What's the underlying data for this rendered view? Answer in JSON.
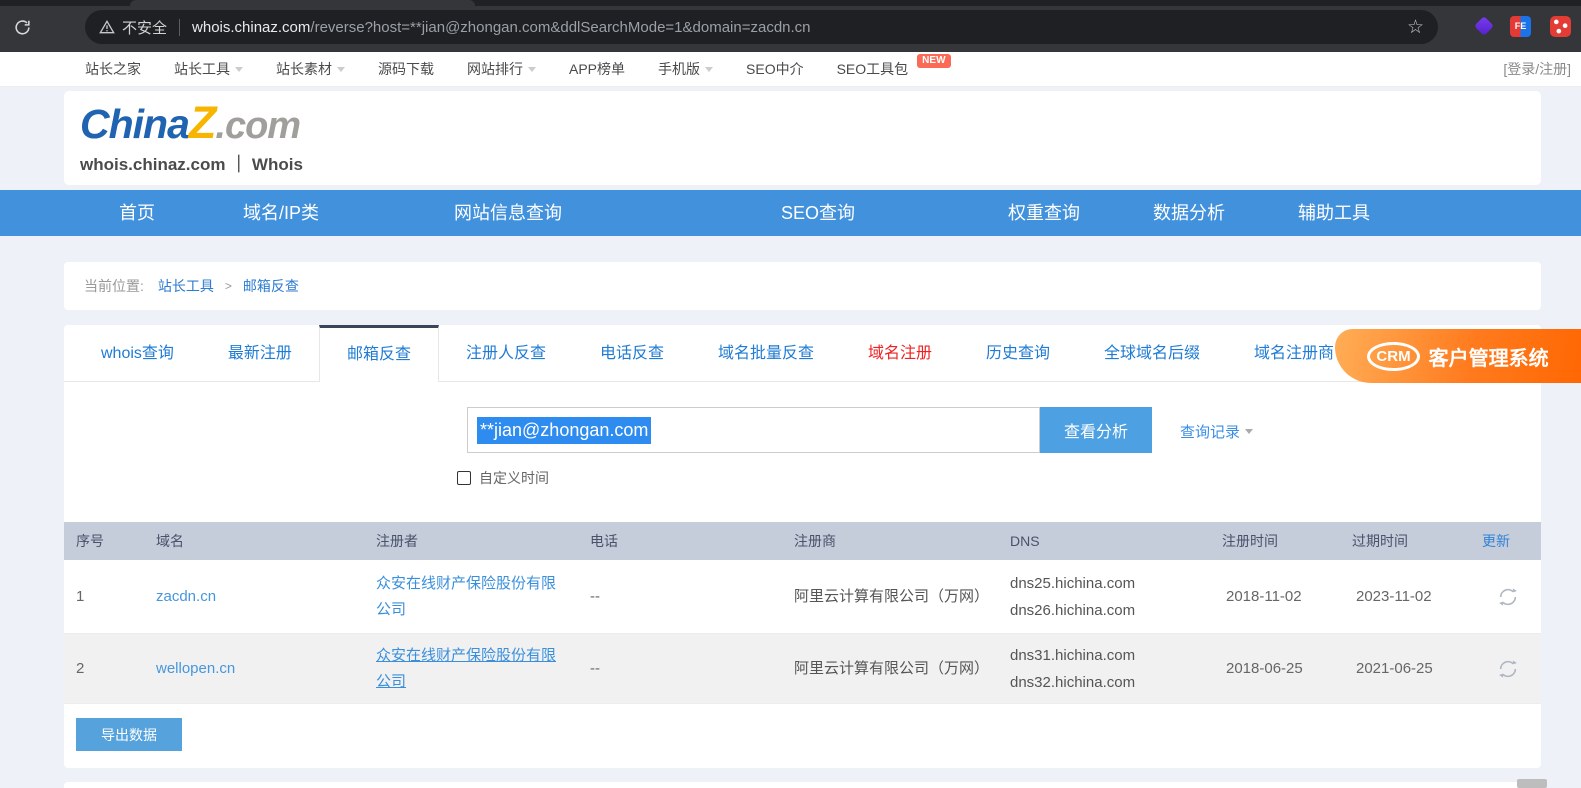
{
  "browser": {
    "security_label": "不安全",
    "url_host": "whois.chinaz.com",
    "url_rest": "/reverse?host=**jian@zhongan.com&ddlSearchMode=1&domain=zacdn.cn",
    "star_icon": "☆"
  },
  "topnav": {
    "items": [
      {
        "label": "站长之家"
      },
      {
        "label": "站长工具"
      },
      {
        "label": "站长素材"
      },
      {
        "label": "源码下载"
      },
      {
        "label": "网站排行"
      },
      {
        "label": "APP榜单"
      },
      {
        "label": "手机版"
      },
      {
        "label": "SEO中介"
      },
      {
        "label": "SEO工具包"
      }
    ],
    "new_badge": "NEW",
    "login": "[登录/注册]"
  },
  "header": {
    "brand_part1": "China",
    "brand_part2": "Z",
    "brand_part3": ".com",
    "subtitle": "whois.chinaz.com ｜ Whois"
  },
  "mainnav": {
    "items": [
      "首页",
      "域名/IP类",
      "网站信息查询",
      "SEO查询",
      "权重查询",
      "数据分析",
      "辅助工具"
    ]
  },
  "breadcrumb": {
    "label": "当前位置:",
    "link1": "站长工具",
    "sep": ">",
    "link2": "邮箱反查"
  },
  "tabs": [
    {
      "label": "whois查询"
    },
    {
      "label": "最新注册"
    },
    {
      "label": "邮箱反查"
    },
    {
      "label": "注册人反查"
    },
    {
      "label": "电话反查"
    },
    {
      "label": "域名批量反查"
    },
    {
      "label": "域名注册"
    },
    {
      "label": "历史查询"
    },
    {
      "label": "全球域名后缀"
    },
    {
      "label": "域名注册商"
    }
  ],
  "crm_banner": {
    "logo": "CRM",
    "label": "客户管理系统"
  },
  "search": {
    "value": "**jian@zhongan.com",
    "analyze_button": "查看分析",
    "history_link": "查询记录",
    "custom_time": "自定义时间"
  },
  "table": {
    "headers": [
      "序号",
      "域名",
      "注册者",
      "电话",
      "注册商",
      "DNS",
      "注册时间",
      "过期时间",
      "更新"
    ],
    "rows": [
      {
        "index": "1",
        "domain": "zacdn.cn",
        "registrant": "众安在线财产保险股份有限公司",
        "phone": "--",
        "registrar": "阿里云计算有限公司（万网）",
        "dns1": "dns25.hichina.com",
        "dns2": "dns26.hichina.com",
        "reg_date": "2018-11-02",
        "exp_date": "2023-11-02"
      },
      {
        "index": "2",
        "domain": "wellopen.cn",
        "registrant": "众安在线财产保险股份有限公司",
        "phone": "--",
        "registrar": "阿里云计算有限公司（万网）",
        "dns1": "dns31.hichina.com",
        "dns2": "dns32.hichina.com",
        "reg_date": "2018-06-25",
        "exp_date": "2021-06-25"
      }
    ]
  },
  "export_button": "导出数据",
  "colors": {
    "accent_blue": "#4191dd",
    "link_blue": "#2d7cd0",
    "tab_red": "#ee2222",
    "button_blue": "#4da1e3",
    "crm_orange": "#ff6c12",
    "table_header_bg": "#c5ccda",
    "selection_blue": "#2e8cf0"
  }
}
